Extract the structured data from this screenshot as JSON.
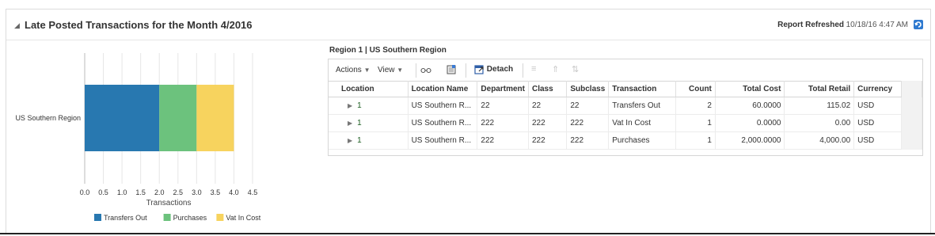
{
  "header": {
    "title": "Late Posted Transactions for the Month 4/2016",
    "refresh_label": "Report Refreshed",
    "refresh_time": "10/18/16 4:47 AM"
  },
  "chart_data": {
    "type": "bar",
    "orientation": "horizontal",
    "stacked": true,
    "categories": [
      "US Southern Region"
    ],
    "series": [
      {
        "name": "Transfers Out",
        "values": [
          2
        ],
        "color": "#2878b0"
      },
      {
        "name": "Purchases",
        "values": [
          1
        ],
        "color": "#6cc27d"
      },
      {
        "name": "Vat In Cost",
        "values": [
          1
        ],
        "color": "#f7d35e"
      }
    ],
    "xlabel": "Transactions",
    "xlim": [
      0,
      4.5
    ],
    "xticks": [
      "0.0",
      "0.5",
      "1.0",
      "1.5",
      "2.0",
      "2.5",
      "3.0",
      "3.5",
      "4.0",
      "4.5"
    ],
    "legend_position": "bottom",
    "grid": true
  },
  "region": {
    "title": "Region 1 | US Southern Region"
  },
  "toolbar": {
    "actions": "Actions",
    "view": "View",
    "detach": "Detach"
  },
  "table": {
    "columns": [
      "Location",
      "Location Name",
      "Department",
      "Class",
      "Subclass",
      "Transaction",
      "Count",
      "Total Cost",
      "Total Retail",
      "Currency"
    ],
    "rows": [
      [
        "1",
        "US Southern R...",
        "22",
        "22",
        "22",
        "Transfers Out",
        "2",
        "60.0000",
        "115.02",
        "USD"
      ],
      [
        "1",
        "US Southern R...",
        "222",
        "222",
        "222",
        "Vat In Cost",
        "1",
        "0.0000",
        "0.00",
        "USD"
      ],
      [
        "1",
        "US Southern R...",
        "222",
        "222",
        "222",
        "Purchases",
        "1",
        "2,000.0000",
        "4,000.00",
        "USD"
      ]
    ]
  },
  "colors": {
    "accent": "#2878b0",
    "link": "#1b5e20"
  }
}
